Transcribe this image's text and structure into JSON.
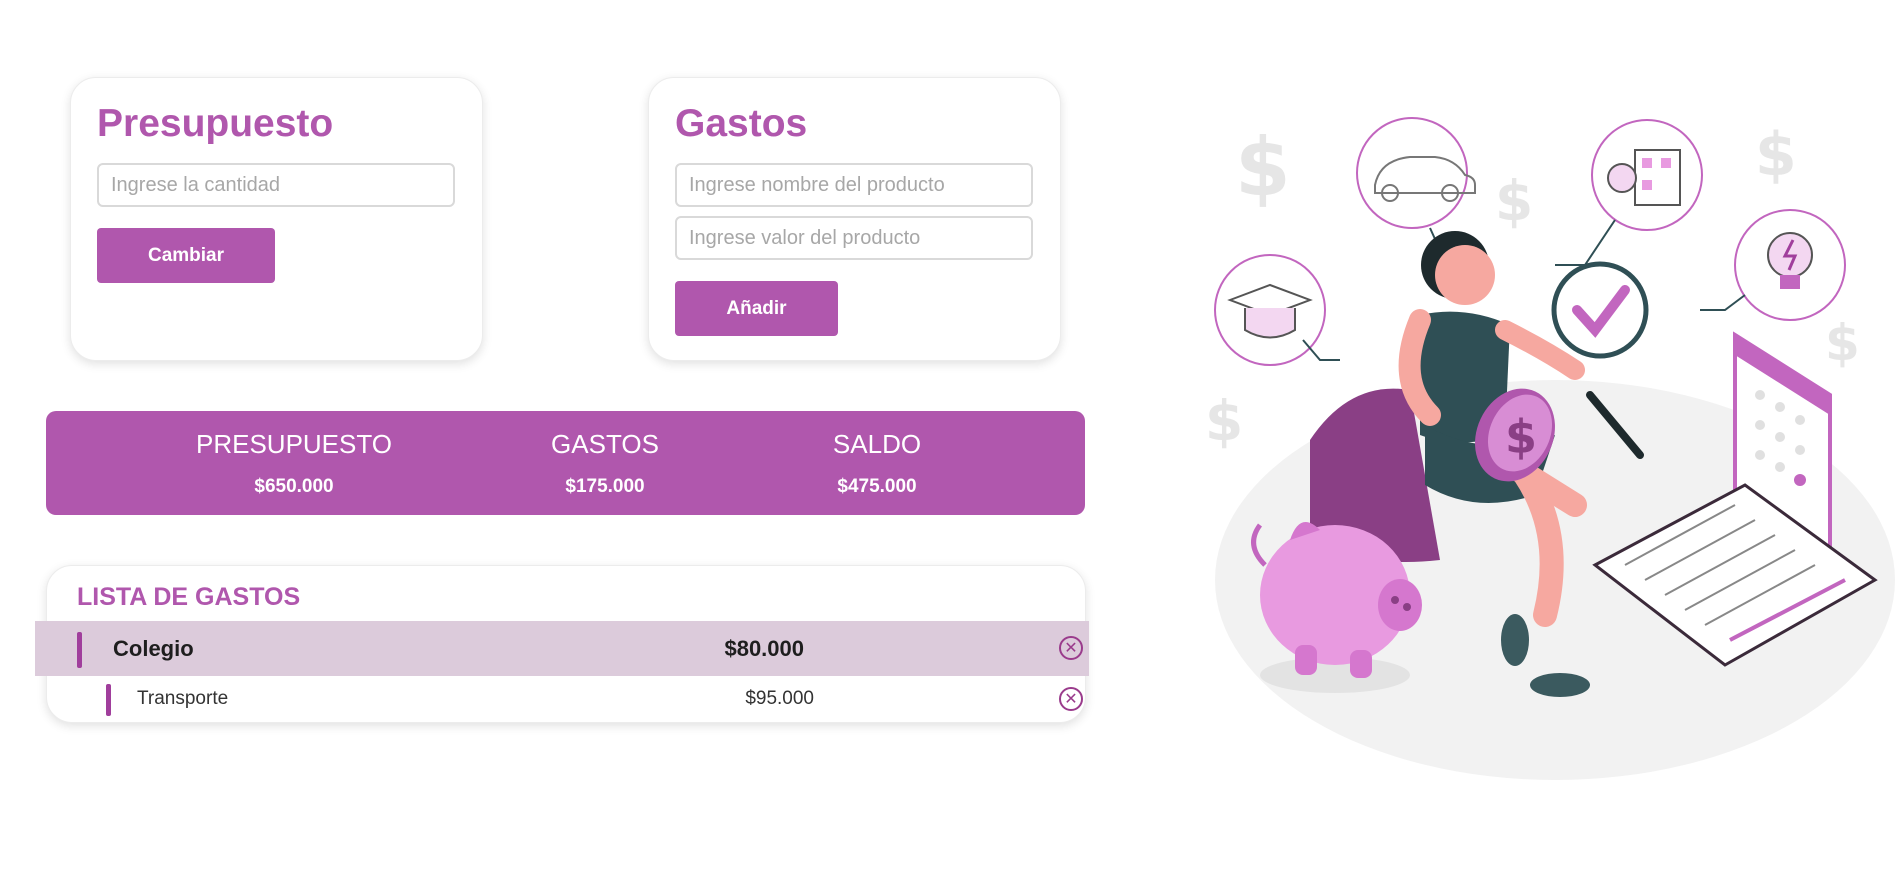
{
  "presupuesto_card": {
    "title": "Presupuesto",
    "amount_placeholder": "Ingrese la cantidad",
    "change_button": "Cambiar"
  },
  "gastos_card": {
    "title": "Gastos",
    "name_placeholder": "Ingrese nombre del producto",
    "value_placeholder": "Ingrese valor del producto",
    "add_button": "Añadir"
  },
  "summary": {
    "presupuesto_label": "PRESUPUESTO",
    "presupuesto_value": "$650.000",
    "gastos_label": "GASTOS",
    "gastos_value": "$175.000",
    "saldo_label": "SALDO",
    "saldo_value": "$475.000"
  },
  "expense_list": {
    "title": "LISTA DE GASTOS",
    "items": [
      {
        "name": "Colegio",
        "value": "$80.000",
        "selected": true
      },
      {
        "name": "Transporte",
        "value": "$95.000",
        "selected": false
      }
    ],
    "delete_icon": "circle-x-icon"
  },
  "colors": {
    "accent": "#b057ad",
    "selected_row": "#dccbdb",
    "row_marker": "#a03e9c"
  },
  "illustration": {
    "subject": "woman holding coin with piggy bank and finance icons",
    "icons": [
      "dollar-sign-icon",
      "car-icon",
      "house-icon",
      "graduation-cap-icon",
      "lightbulb-icon",
      "checkmark-icon",
      "piggy-bank-icon",
      "calendar-icon",
      "notebook-icon",
      "pencil-icon",
      "coin-icon"
    ]
  }
}
